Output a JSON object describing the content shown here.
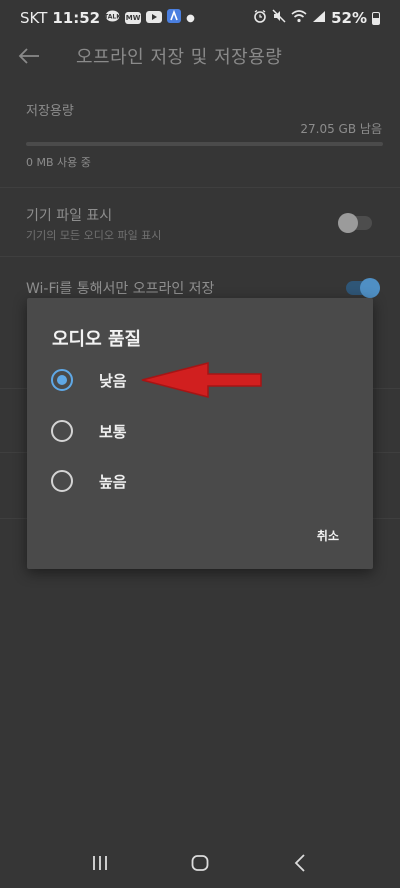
{
  "status_bar": {
    "carrier": "SKT",
    "time": "11:52",
    "badge1": "💬",
    "badge2": "MW",
    "battery": "52%"
  },
  "header": {
    "title": "오프라인 저장 및 저장용량"
  },
  "storage": {
    "label": "저장용량",
    "free": "27.05 GB 남음",
    "used": "0 MB 사용 중"
  },
  "settings": {
    "device_files_title": "기기 파일 표시",
    "device_files_sub": "기기의 모든 오디오 파일 표시",
    "wifi_only_title": "Wi-Fi를 통해서만 오프라인 저장"
  },
  "dialog": {
    "title": "오디오 품질",
    "options": [
      {
        "label": "낮음",
        "selected": true
      },
      {
        "label": "보통",
        "selected": false
      },
      {
        "label": "높음",
        "selected": false
      }
    ],
    "cancel_label": "취소"
  },
  "colors": {
    "accent": "#5fa8e6",
    "background": "#363636",
    "dialog": "#4a4a4a",
    "annotation_arrow": "#d11f1f"
  },
  "icons": [
    "back-arrow-icon",
    "recent-apps-icon",
    "home-icon",
    "nav-back-icon",
    "battery-icon",
    "wifi-icon",
    "mute-icon",
    "alarm-icon",
    "signal-icon"
  ]
}
